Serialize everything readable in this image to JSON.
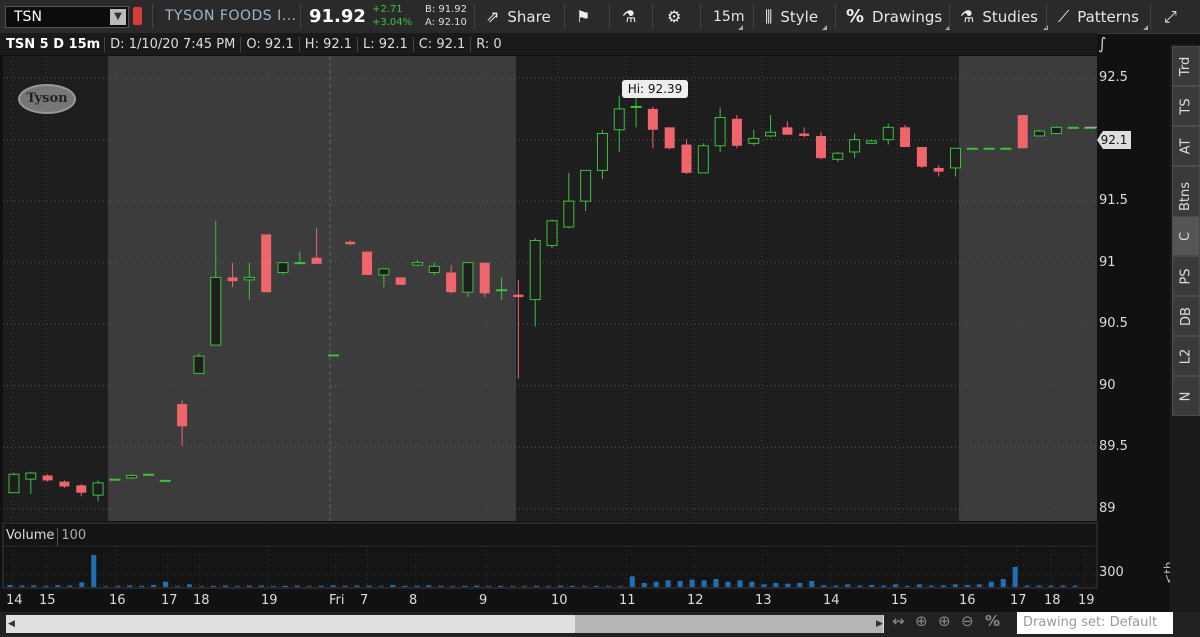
{
  "toolbar": {
    "symbol": "TSN",
    "company": "TYSON FOODS I...",
    "last": "91.92",
    "change": "+2.71",
    "change_pct": "+3.04%",
    "bid": "B: 91.92",
    "ask": "A: 92.10",
    "share": "Share",
    "interval": "15m",
    "style": "Style",
    "drawings": "Drawings",
    "studies": "Studies",
    "patterns": "Patterns"
  },
  "info_bar": {
    "symbol": "TSN 5 D 15m",
    "date": "D: 1/10/20 7:45 PM",
    "open": "O: 92.1",
    "high": "H: 92.1",
    "low": "L: 92.1",
    "close": "C: 92.1",
    "range": "R: 0"
  },
  "right_tabs": [
    "Trd",
    "TS",
    "AT",
    "Btns",
    "C",
    "PS",
    "DB",
    "L2",
    "N"
  ],
  "price_axis": [
    "92.5",
    "92",
    "91.5",
    "91",
    "90.5",
    "90",
    "89.5",
    "89"
  ],
  "last_price_tag": "92.1",
  "hi_tooltip": "Hi: 92.39",
  "logo_text": "Tyson",
  "volume_panel": {
    "label": "Volume",
    "value": "100",
    "axis_label": "300",
    "th_label": "<th..."
  },
  "x_axis": [
    "14",
    "15",
    "16",
    "17",
    "18",
    "19",
    "Fri",
    "7",
    "8",
    "9",
    "10",
    "11",
    "12",
    "13",
    "14",
    "15",
    "16",
    "17",
    "18",
    "19"
  ],
  "drawing_set": "Drawing set: Default",
  "colors": {
    "up": "#3cc13c",
    "down": "#f0646c",
    "volume": "#1f6fb5",
    "session_light": "#3c3c3c",
    "session_dark": "#1e1e1e"
  },
  "chart_data": {
    "type": "candlestick",
    "price_range": [
      88.9,
      92.68
    ],
    "volume_range": [
      0,
      300
    ],
    "candles": [
      {
        "o": 89.13,
        "h": 89.29,
        "l": 89.13,
        "c": 89.28
      },
      {
        "o": 89.24,
        "h": 89.3,
        "l": 89.12,
        "c": 89.29
      },
      {
        "o": 89.27,
        "h": 89.28,
        "l": 89.22,
        "c": 89.23
      },
      {
        "o": 89.22,
        "h": 89.23,
        "l": 89.17,
        "c": 89.18
      },
      {
        "o": 89.19,
        "h": 89.2,
        "l": 89.1,
        "c": 89.13
      },
      {
        "o": 89.11,
        "h": 89.23,
        "l": 89.06,
        "c": 89.21
      },
      {
        "o": 89.24,
        "h": 89.24,
        "l": 89.24,
        "c": 89.24
      },
      {
        "o": 89.25,
        "h": 89.28,
        "l": 89.24,
        "c": 89.27
      },
      {
        "o": 89.28,
        "h": 89.28,
        "l": 89.28,
        "c": 89.28
      },
      {
        "o": 89.23,
        "h": 89.23,
        "l": 89.23,
        "c": 89.23
      },
      {
        "o": 89.85,
        "h": 89.88,
        "l": 89.51,
        "c": 89.67
      },
      {
        "o": 90.1,
        "h": 90.26,
        "l": 90.1,
        "c": 90.24
      },
      {
        "o": 90.33,
        "h": 91.34,
        "l": 90.33,
        "c": 90.88
      },
      {
        "o": 90.88,
        "h": 91.0,
        "l": 90.8,
        "c": 90.85
      },
      {
        "o": 90.86,
        "h": 91.0,
        "l": 90.7,
        "c": 90.88
      },
      {
        "o": 91.23,
        "h": 91.23,
        "l": 90.76,
        "c": 90.76
      },
      {
        "o": 90.92,
        "h": 91.0,
        "l": 90.9,
        "c": 91.0
      },
      {
        "o": 91.0,
        "h": 91.09,
        "l": 91.0,
        "c": 91.0
      },
      {
        "o": 91.04,
        "h": 91.28,
        "l": 91.02,
        "c": 90.99
      },
      {
        "o": 90.25,
        "h": 90.25,
        "l": 90.25,
        "c": 90.25
      },
      {
        "o": 91.17,
        "h": 91.18,
        "l": 91.14,
        "c": 91.15
      },
      {
        "o": 91.09,
        "h": 91.09,
        "l": 90.9,
        "c": 90.9
      },
      {
        "o": 90.9,
        "h": 90.95,
        "l": 90.8,
        "c": 90.95
      },
      {
        "o": 90.88,
        "h": 90.88,
        "l": 90.82,
        "c": 90.82
      },
      {
        "o": 90.98,
        "h": 91.02,
        "l": 90.97,
        "c": 91.0
      },
      {
        "o": 90.92,
        "h": 91.0,
        "l": 90.9,
        "c": 90.97
      },
      {
        "o": 90.92,
        "h": 90.98,
        "l": 90.75,
        "c": 90.76
      },
      {
        "o": 90.76,
        "h": 91.0,
        "l": 90.72,
        "c": 91.0
      },
      {
        "o": 91.0,
        "h": 91.0,
        "l": 90.72,
        "c": 90.75
      },
      {
        "o": 90.78,
        "h": 90.88,
        "l": 90.7,
        "c": 90.78
      },
      {
        "o": 90.74,
        "h": 90.86,
        "l": 90.06,
        "c": 90.72
      },
      {
        "o": 90.7,
        "h": 91.2,
        "l": 90.48,
        "c": 91.18
      },
      {
        "o": 91.14,
        "h": 91.35,
        "l": 91.12,
        "c": 91.34
      },
      {
        "o": 91.29,
        "h": 91.73,
        "l": 91.28,
        "c": 91.5
      },
      {
        "o": 91.5,
        "h": 91.75,
        "l": 91.42,
        "c": 91.75
      },
      {
        "o": 91.75,
        "h": 92.08,
        "l": 91.68,
        "c": 92.05
      },
      {
        "o": 92.08,
        "h": 92.36,
        "l": 91.9,
        "c": 92.25
      },
      {
        "o": 92.27,
        "h": 92.37,
        "l": 92.1,
        "c": 92.27
      },
      {
        "o": 92.25,
        "h": 92.27,
        "l": 91.93,
        "c": 92.08
      },
      {
        "o": 92.1,
        "h": 92.1,
        "l": 91.92,
        "c": 91.93
      },
      {
        "o": 91.96,
        "h": 92.0,
        "l": 91.72,
        "c": 91.73
      },
      {
        "o": 91.73,
        "h": 91.97,
        "l": 91.73,
        "c": 91.95
      },
      {
        "o": 91.95,
        "h": 92.26,
        "l": 91.9,
        "c": 92.18
      },
      {
        "o": 92.17,
        "h": 92.2,
        "l": 91.93,
        "c": 91.95
      },
      {
        "o": 91.97,
        "h": 92.08,
        "l": 91.95,
        "c": 92.01
      },
      {
        "o": 92.03,
        "h": 92.2,
        "l": 92.02,
        "c": 92.06
      },
      {
        "o": 92.1,
        "h": 92.15,
        "l": 92.04,
        "c": 92.04
      },
      {
        "o": 92.05,
        "h": 92.1,
        "l": 92.02,
        "c": 92.03
      },
      {
        "o": 92.03,
        "h": 92.06,
        "l": 91.84,
        "c": 91.85
      },
      {
        "o": 91.84,
        "h": 91.9,
        "l": 91.82,
        "c": 91.89
      },
      {
        "o": 91.9,
        "h": 92.05,
        "l": 91.85,
        "c": 92.0
      },
      {
        "o": 91.97,
        "h": 92.0,
        "l": 91.97,
        "c": 91.99
      },
      {
        "o": 92.0,
        "h": 92.13,
        "l": 91.96,
        "c": 92.1
      },
      {
        "o": 92.1,
        "h": 92.12,
        "l": 91.94,
        "c": 91.94
      },
      {
        "o": 91.94,
        "h": 91.94,
        "l": 91.77,
        "c": 91.78
      },
      {
        "o": 91.77,
        "h": 91.79,
        "l": 91.7,
        "c": 91.74
      },
      {
        "o": 91.77,
        "h": 91.92,
        "l": 91.7,
        "c": 91.93
      },
      {
        "o": 91.93,
        "h": 91.93,
        "l": 91.93,
        "c": 91.93
      },
      {
        "o": 91.93,
        "h": 91.93,
        "l": 91.93,
        "c": 91.93
      },
      {
        "o": 91.93,
        "h": 91.93,
        "l": 91.93,
        "c": 91.93
      },
      {
        "o": 92.2,
        "h": 92.2,
        "l": 91.93,
        "c": 91.93
      },
      {
        "o": 92.03,
        "h": 92.08,
        "l": 92.03,
        "c": 92.07
      },
      {
        "o": 92.05,
        "h": 92.11,
        "l": 92.05,
        "c": 92.1
      },
      {
        "o": 92.1,
        "h": 92.1,
        "l": 92.1,
        "c": 92.1
      },
      {
        "o": 92.1,
        "h": 92.1,
        "l": 92.1,
        "c": 92.1
      }
    ],
    "volumes": [
      15,
      10,
      12,
      8,
      14,
      10,
      35,
      240,
      5,
      8,
      12,
      8,
      15,
      40,
      5,
      20,
      5,
      8,
      10,
      6,
      10,
      10,
      6,
      8,
      10,
      6,
      8,
      12,
      8,
      10,
      10,
      5,
      15,
      8,
      8,
      12,
      8,
      6,
      8,
      10,
      6,
      8,
      6,
      6,
      8,
      6,
      10,
      8,
      6,
      8,
      6,
      6,
      80,
      30,
      40,
      50,
      45,
      55,
      50,
      60,
      40,
      50,
      40,
      20,
      30,
      25,
      30,
      45,
      12,
      10,
      20,
      10,
      15,
      10,
      20,
      8,
      20,
      10,
      12,
      20,
      15,
      20,
      40,
      60,
      150,
      10,
      10,
      10,
      10,
      10
    ]
  }
}
